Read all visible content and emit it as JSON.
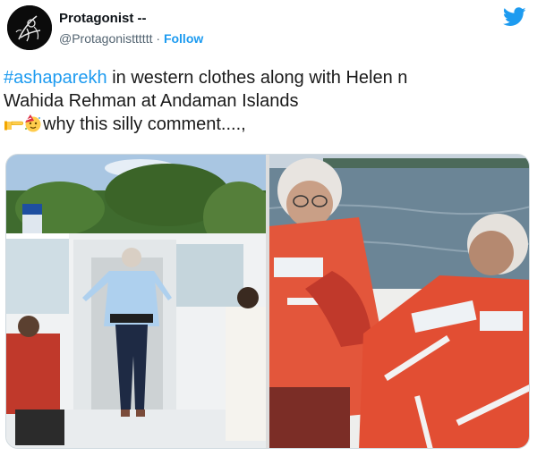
{
  "author": {
    "display_name": "Protagonist --",
    "handle": "@Protagonistttttt",
    "separator": "·",
    "follow_label": "Follow"
  },
  "tweet": {
    "hashtag": "#ashaparekh",
    "line1_rest": " in western clothes along with Helen n",
    "line2": "Wahida Rehman at Andaman Islands",
    "line3": "why this silly comment....,"
  },
  "icons": {
    "brand": "twitter-bird-icon",
    "emoji1": "backhand-index-pointing-right-icon",
    "emoji2": "partying-face-icon",
    "brand_color": "#1d9bf0"
  },
  "media": {
    "image_left": "boat-deck-photo",
    "image_right": "life-jackets-photo"
  }
}
